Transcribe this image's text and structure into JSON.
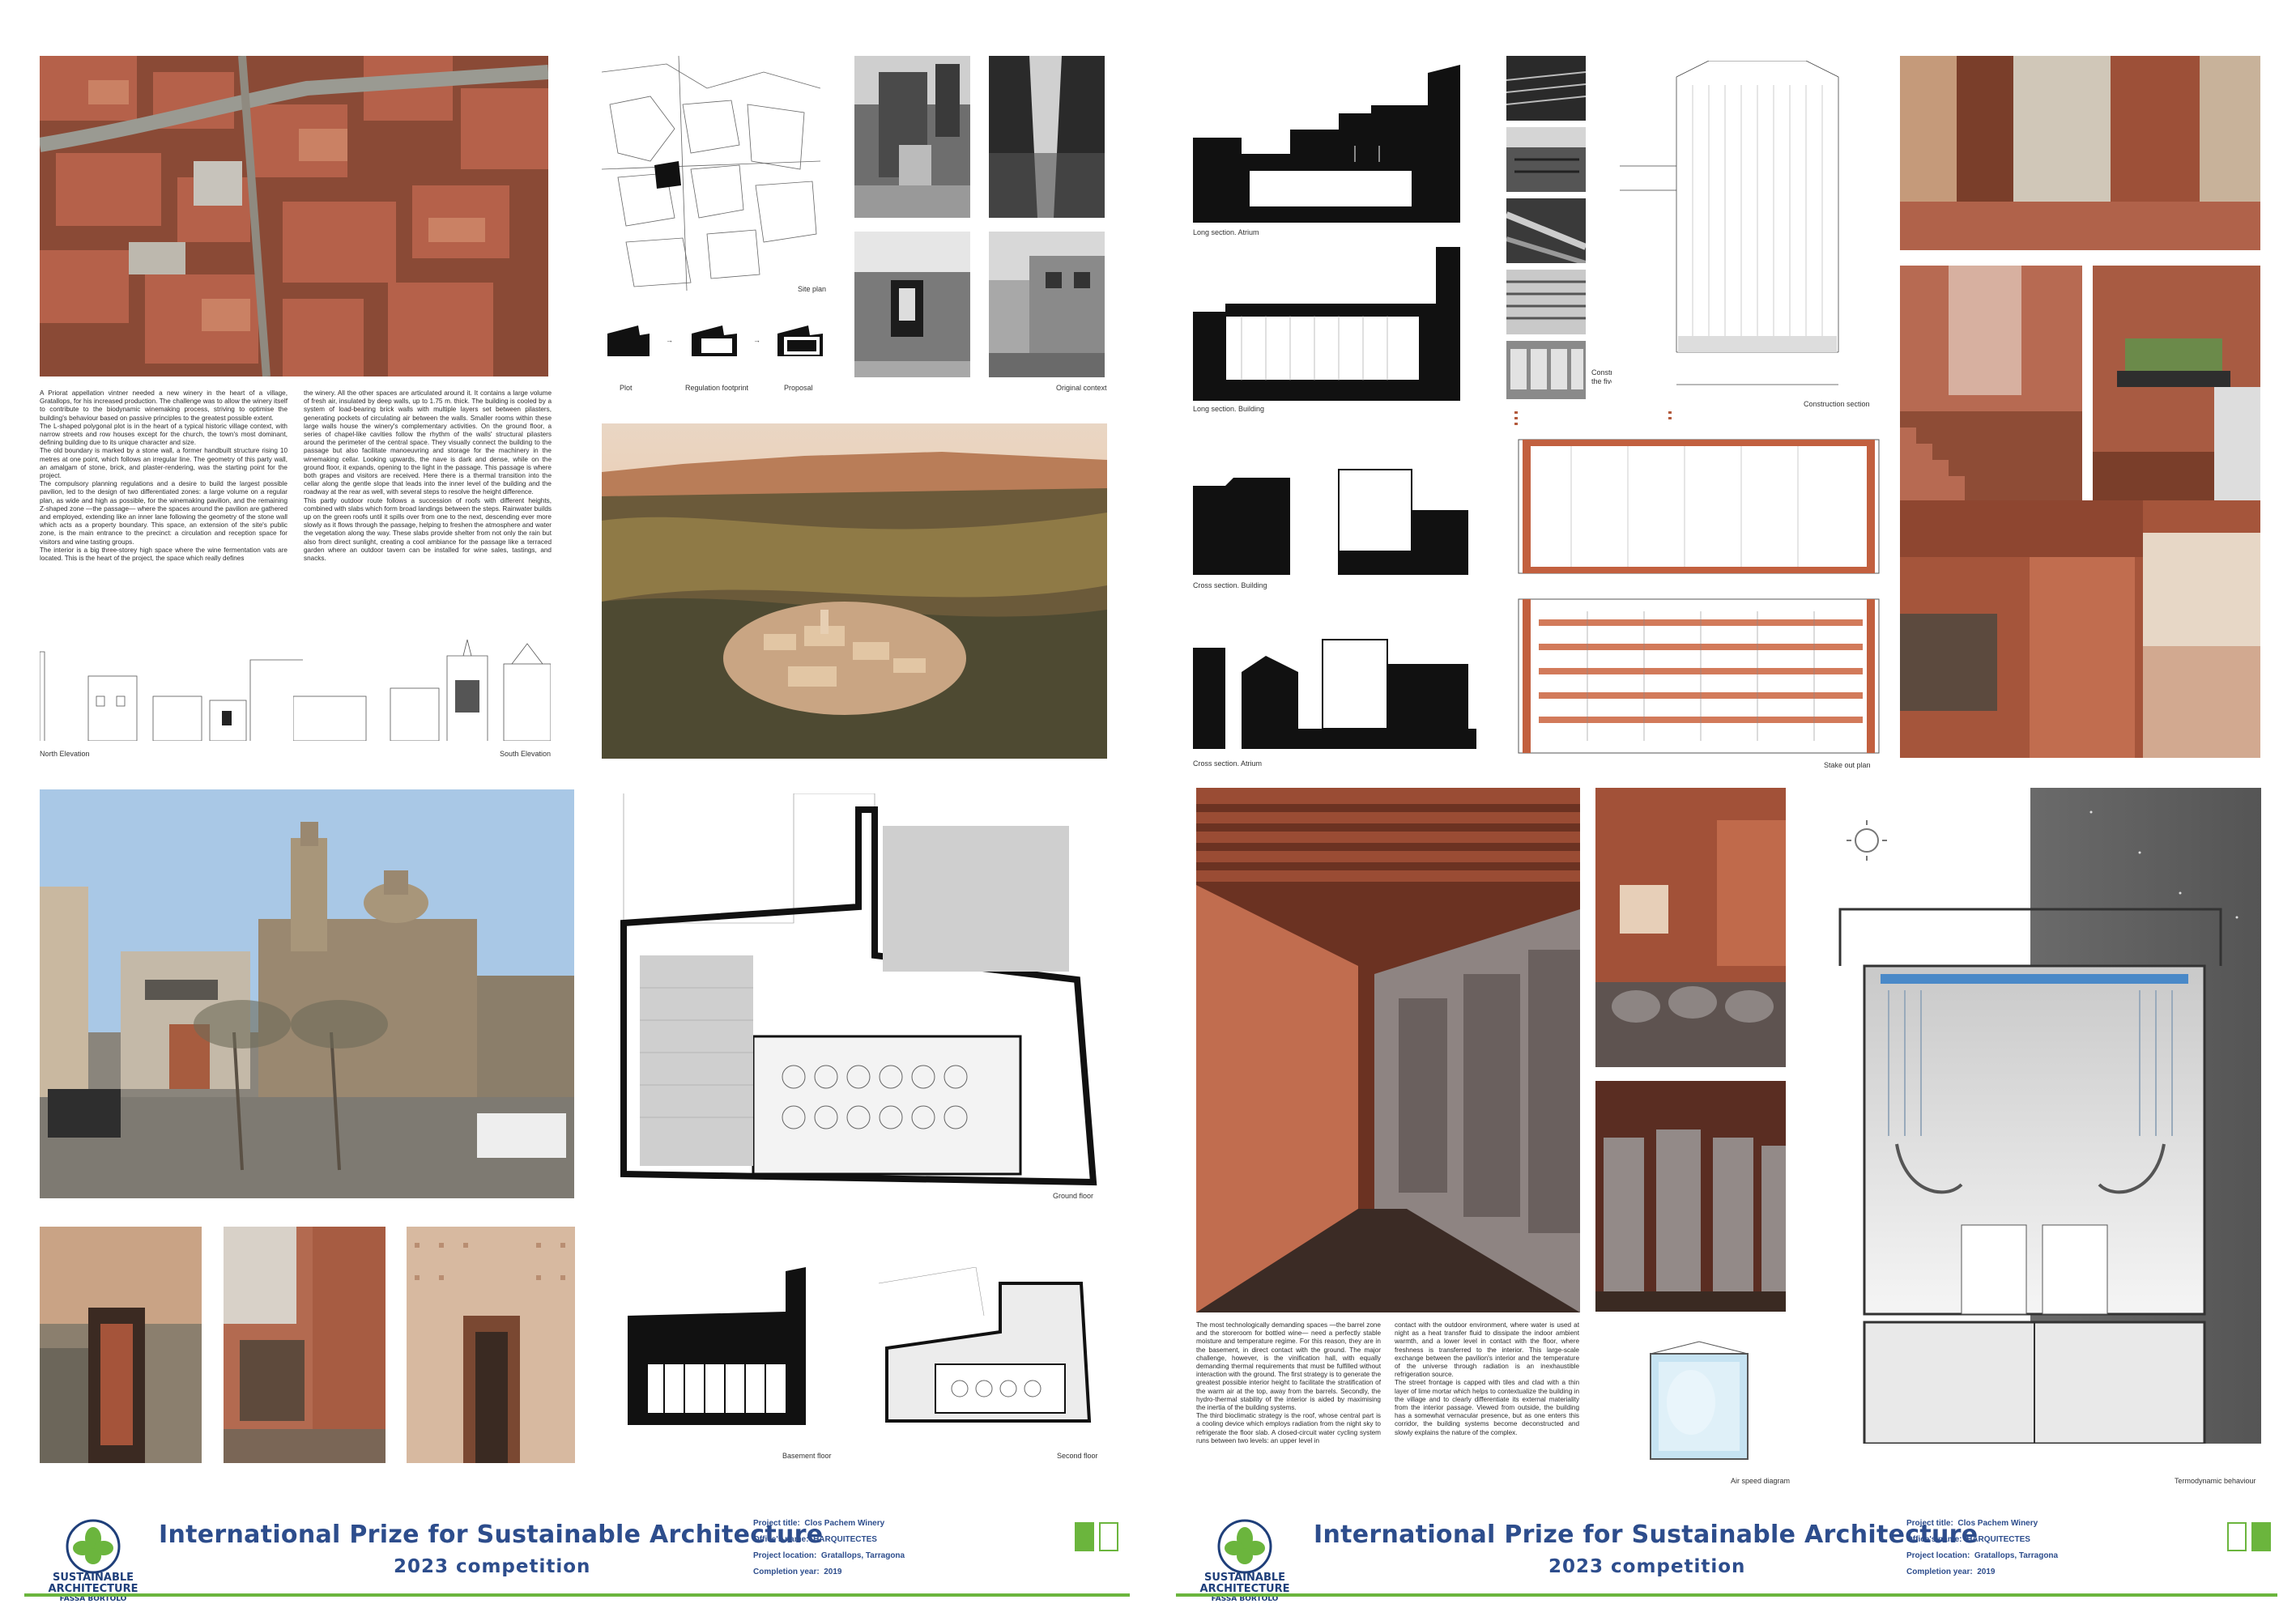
{
  "colors": {
    "title_blue": "#2d4d8c",
    "accent_green": "#6bb53d",
    "brick": "#a8543a",
    "brick_dark": "#7a3a26",
    "sky": "#9fc2e0"
  },
  "left_panel": {
    "intro_text_col1": "A Priorat appellation vintner needed a new winery in the heart of a village, Gratallops, for his increased production. The challenge was to allow the winery itself to contribute to the biodynamic winemaking process, striving to optimise the building's behaviour based on passive principles to the greatest possible extent.\nThe L-shaped polygonal plot is in the heart of a typical historic village context, with narrow streets and row houses except for the church, the town's most dominant, defining building due to its unique character and size.\nThe old boundary is marked by a stone wall, a former handbuilt structure rising 10 metres at one point, which follows an irregular line. The geometry of this party wall, an amalgam of stone, brick, and plaster-rendering, was the starting point for the project.\nThe compulsory planning regulations and a desire to build the largest possible pavilion, led to the design of two differentiated zones: a large volume on a regular plan, as wide and high as possible, for the winemaking pavilion, and the remaining Z-shaped zone —the passage— where the spaces around the pavilion are gathered and employed, extending like an inner lane following the geometry of the stone wall which acts as a property boundary. This space, an extension of the site's public zone, is the main entrance to the precinct: a circulation and reception space for visitors and wine tasting groups.\nThe interior is a big three-storey high space where the wine fermentation vats are located. This is the heart of the project, the space which really defines",
    "intro_text_col2": "the winery. All the other spaces are articulated around it. It contains a large volume of fresh air, insulated by deep walls, up to 1.75 m. thick. The building is cooled by a system of load-bearing brick walls with multiple layers set between pilasters, generating pockets of circulating air between the walls. Smaller rooms within these large walls house the winery's complementary activities. On the ground floor, a series of chapel-like cavities follow the rhythm of the walls' structural pilasters around the perimeter of the central space. They visually connect the building to the passage but also facilitate manoeuvring and storage for the machinery in the winemaking cellar. Looking upwards, the nave is dark and dense, while on the ground floor, it expands, opening to the light in the passage. This passage is where both grapes and visitors are received. Here there is a thermal transition into the cellar along the gentle slope that leads into the inner level of the building and the roadway at the rear as well, with several steps to resolve the height difference.\nThis partly outdoor route follows a succession of roofs with different heights, combined with slabs which form broad landings between the steps. Rainwater builds up on the green roofs until it spills over from one to the next, descending ever more slowly as it flows through the passage, helping to freshen the atmosphere and water the vegetation along the way. These slabs provide shelter from not only the rain but also from direct sunlight, creating a cool ambiance for the passage like a terraced garden where an outdoor tavern can be installed for wine sales, tastings, and snacks.",
    "captions": {
      "site_plan": "Site plan",
      "plot": "Plot",
      "regulation": "Regulation footprint",
      "proposal": "Proposal",
      "original_context": "Original context",
      "north_elevation": "North Elevation",
      "south_elevation": "South Elevation",
      "ground_floor": "Ground floor",
      "basement_floor": "Basement floor",
      "second_floor": "Second floor"
    }
  },
  "right_panel": {
    "captions": {
      "long_section_atrium": "Long section. Atrium",
      "long_section_building": "Long section. Building",
      "cross_section_building": "Cross section. Building",
      "cross_section_atrium": "Cross section. Atrium",
      "construction_process": "Construction process of the five layer brick wall.",
      "construction_section": "Construction section",
      "stake_out_plan": "Stake out plan",
      "air_speed": "Air speed diagram",
      "thermodynamic": "Termodynamic behaviour"
    },
    "bottom_text_col1": "The most technologically demanding spaces —the barrel zone and the storeroom for bottled wine— need a perfectly stable moisture and temperature regime. For this reason, they are in the basement, in direct contact with the ground. The major challenge, however, is the vinification hall, with equally demanding thermal requirements that must be fulfilled without interaction with the ground. The first strategy is to generate the greatest possible interior height to facilitate the stratification of the warm air at the top, away from the barrels. Secondly, the hydro-thermal stability of the interior is aided by maximising the inertia of the building systems.\nThe third bioclimatic strategy is the roof, whose central part is a cooling device which employs radiation from the night sky to refrigerate the floor slab. A closed-circuit water cycling system runs between two levels: an upper level in",
    "bottom_text_col2": "contact with the outdoor environment, where water is used at night as a heat transfer fluid to dissipate the indoor ambient warmth, and a lower level in contact with the floor, where freshness is transferred to the interior. This large-scale exchange between the pavilion's interior and the temperature of the universe through radiation is an inexhaustible refrigeration source.\nThe street frontage is capped with tiles and clad with a thin layer of lime mortar which helps to contextualize the building in the village and to clearly differentiate its external materiality from the interior passage. Viewed from outside, the building has a somewhat vernacular presence, but as one enters this corridor, the building systems become deconstructed and slowly explains the nature of the complex."
  },
  "footer": {
    "title": "International Prize for Sustainable Architecture",
    "subtitle": "2023 competition",
    "labels": {
      "project_title": "Project title:",
      "office": "Office's name:",
      "location": "Project location:",
      "year": "Completion year:"
    },
    "values": {
      "project_title": "Clos Pachem Winery",
      "office": "HARQUITECTES",
      "location": "Gratallops, Tarragona",
      "year": "2019"
    },
    "logo": {
      "line1": "SUSTAINABLE",
      "line2": "ARCHITECTURE",
      "line3": "FASSA BORTOLO",
      "ring": "INTERNATIONAL PRIZE"
    }
  }
}
